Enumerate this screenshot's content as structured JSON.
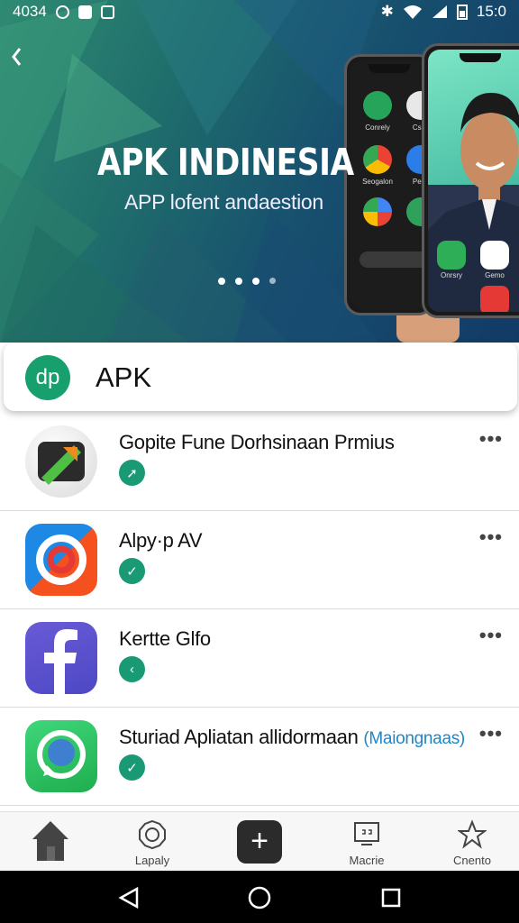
{
  "status_bar": {
    "time": "4034",
    "clock_right": "15:0",
    "left_icons": [
      "clock-alarm-icon",
      "image-icon",
      "camera-icon"
    ],
    "right_icons": [
      "bluetooth-icon",
      "wifi-icon",
      "signal-icon",
      "battery-icon"
    ]
  },
  "hero": {
    "title": "APK INDINESIA",
    "subtitle": "APP lofent andaestion",
    "carousel_dots": 4,
    "active_dot": 3,
    "phone_small_apps": [
      "Conrely",
      "Csec",
      "Seogalon",
      "Peec"
    ],
    "phone_big_apps": [
      "Onrsry",
      "Gemo"
    ]
  },
  "header": {
    "logo_text": "dp",
    "title": "APK"
  },
  "apps": [
    {
      "name": "Gopite Fune Dorhsinaan Prmius",
      "tag": "",
      "badge": "➚"
    },
    {
      "name": "Alpy·p AV",
      "tag": "",
      "badge": "✓"
    },
    {
      "name": "Kertte Glfo",
      "tag": "",
      "badge": "‹"
    },
    {
      "name": "Sturiad Apliatan allidormaan",
      "tag": "(Maiongnaas)",
      "badge": "✓"
    }
  ],
  "bottom_nav": {
    "items": [
      {
        "label": "",
        "icon": "home-icon"
      },
      {
        "label": "Lapaly",
        "icon": "settings-icon"
      },
      {
        "label": "",
        "icon": "add-icon"
      },
      {
        "label": "Macrie",
        "icon": "monitor-icon"
      },
      {
        "label": "Cnento",
        "icon": "star-icon"
      }
    ]
  },
  "colors": {
    "accent_green": "#1a9a74",
    "link_blue": "#1f86c7",
    "hero_dark": "#123a66"
  }
}
